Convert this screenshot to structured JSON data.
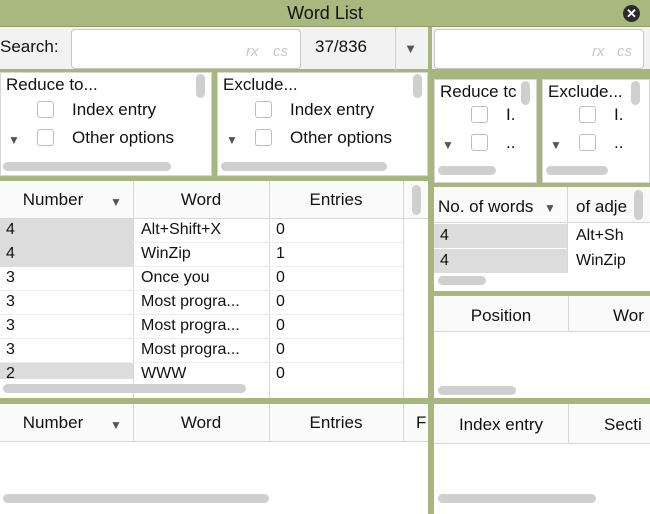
{
  "window": {
    "title": "Word List"
  },
  "search": {
    "label": "Search:",
    "rx": "rx",
    "cs": "cs",
    "count": "37/836",
    "dropdown": "▼"
  },
  "search2": {
    "rx": "rx",
    "cs": "cs"
  },
  "filters": {
    "reduce_title": "Reduce to...",
    "exclude_title": "Exclude...",
    "index_entry": "Index entry",
    "other_options": "Other options",
    "reduce_small": "Reduce tc",
    "exclude_small": "Exclude...",
    "trunc_i": "I.",
    "trunc_dots": ".."
  },
  "table_main": {
    "headers": [
      "Number",
      "Word",
      "Entries"
    ],
    "rows": [
      [
        "4",
        "Alt+Shift+X",
        "0"
      ],
      [
        "4",
        "WinZip",
        "1"
      ],
      [
        "3",
        "Once you",
        "0"
      ],
      [
        "3",
        "Most progra...",
        "0"
      ],
      [
        "3",
        "Most progra...",
        "0"
      ],
      [
        "3",
        "Most progra...",
        "0"
      ],
      [
        "2",
        "WWW",
        "0"
      ]
    ]
  },
  "table_right": {
    "headers": [
      "No. of words",
      "of adje"
    ],
    "rows": [
      [
        "4",
        "Alt+Sh"
      ],
      [
        "4",
        "WinZip"
      ]
    ]
  },
  "position_table": {
    "headers": [
      "Position",
      "Wor"
    ]
  },
  "table_bottom": {
    "headers": [
      "Number",
      "Word",
      "Entries",
      "F"
    ]
  },
  "index_table": {
    "headers": [
      "Index entry",
      "Secti"
    ]
  }
}
